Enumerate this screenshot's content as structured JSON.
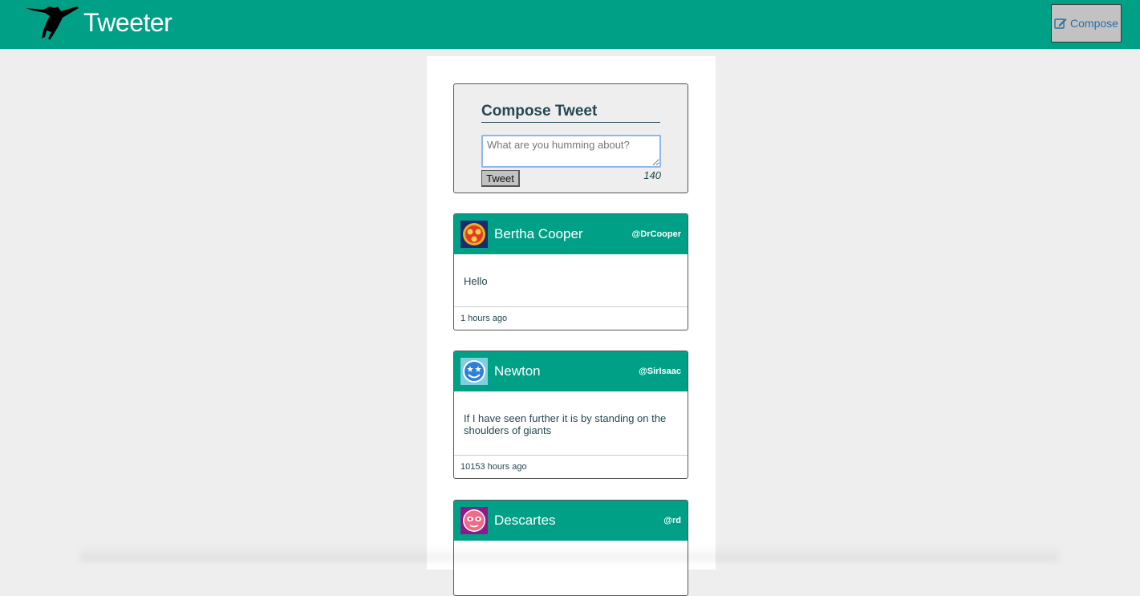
{
  "app": {
    "title": "Tweeter",
    "logo_icon": "hummingbird-icon",
    "accent_color": "#00a087"
  },
  "nav": {
    "compose_label": "Compose",
    "compose_icon": "edit-icon"
  },
  "composer": {
    "title": "Compose Tweet",
    "placeholder": "What are you humming about?",
    "value": "",
    "submit_label": "Tweet",
    "counter": "140"
  },
  "tweets": [
    {
      "name": "Bertha Cooper",
      "handle": "@DrCooper",
      "content": "Hello",
      "time": "1 hours ago",
      "avatar_icon": "avatar-red-face-icon"
    },
    {
      "name": "Newton",
      "handle": "@SirIsaac",
      "content": "If I have seen further it is by standing on the shoulders of giants",
      "time": "10153 hours ago",
      "avatar_icon": "avatar-blue-smiley-icon"
    },
    {
      "name": "Descartes",
      "handle": "@rd",
      "content": "",
      "time": "",
      "avatar_icon": "avatar-pink-face-icon"
    }
  ]
}
